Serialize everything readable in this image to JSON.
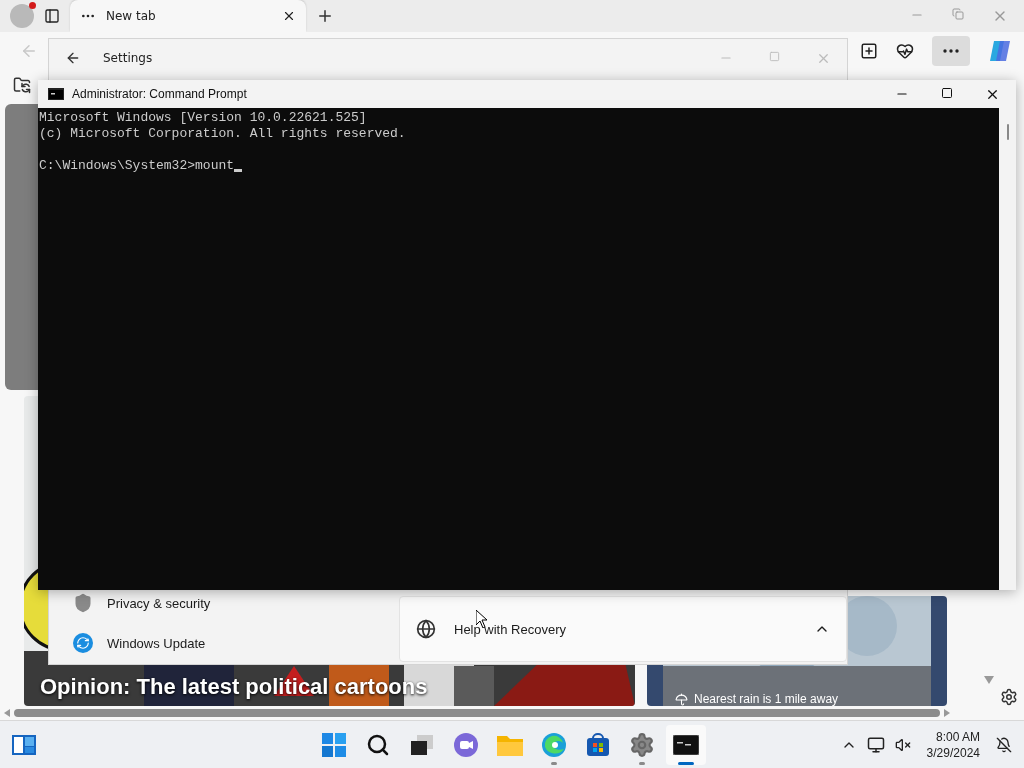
{
  "browser": {
    "tabs": [
      {
        "label": "New tab",
        "selected": true
      }
    ],
    "news": [
      {
        "kind": "picture",
        "headline": "Opinion: The latest political cartoons"
      },
      {
        "kind": "weather",
        "caption": "Nearest rain is 1 mile away"
      }
    ]
  },
  "settings_window": {
    "title": "Settings",
    "nav_items": [
      {
        "kind": "privacy",
        "label": "Privacy & security"
      },
      {
        "kind": "update",
        "label": "Windows Update"
      }
    ],
    "panel": {
      "label": "Help with Recovery",
      "expanded": true
    }
  },
  "console_window": {
    "title": "Administrator: Command Prompt",
    "header_lines": [
      "Microsoft Windows [Version 10.0.22621.525]",
      "(c) Microsoft Corporation. All rights reserved."
    ],
    "prompt": "C:\\Windows\\System32>mount"
  },
  "taskbar": {
    "apps": [
      {
        "kind": "start",
        "running": false,
        "selected": false
      },
      {
        "kind": "search",
        "running": false,
        "selected": false
      },
      {
        "kind": "task-view",
        "running": false,
        "selected": false
      },
      {
        "kind": "chat",
        "running": false,
        "selected": false
      },
      {
        "kind": "files",
        "running": false,
        "selected": false
      },
      {
        "kind": "browser",
        "running": true,
        "selected": false
      },
      {
        "kind": "store",
        "running": false,
        "selected": false
      },
      {
        "kind": "settings",
        "running": true,
        "selected": false
      },
      {
        "kind": "terminal",
        "running": true,
        "selected": true
      }
    ],
    "time": "8:00 AM",
    "date": "3/29/2024"
  }
}
